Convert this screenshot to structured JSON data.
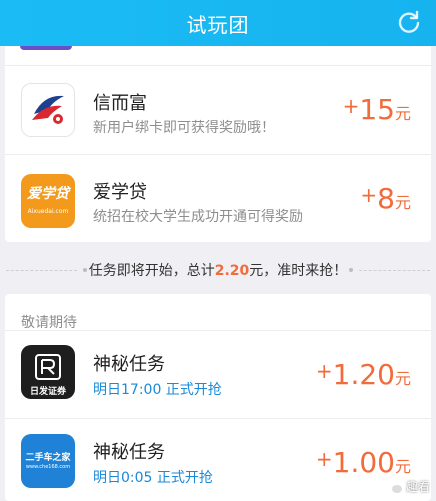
{
  "header": {
    "title": "试玩团",
    "refresh_icon": "refresh-icon"
  },
  "tasks_active": [
    {
      "name": "信而富",
      "desc": "新用户绑卡即可获得奖励哦！",
      "reward_sign": "+",
      "reward_value": "15",
      "reward_unit": "元",
      "logo": "xinerfu-logo"
    },
    {
      "name": "爱学贷",
      "desc": "统招在校大学生成功开通可得奖励",
      "reward_sign": "+",
      "reward_value": "8",
      "reward_unit": "元",
      "logo": "aixuedai-logo",
      "logo_text": "爱学贷",
      "logo_sub": "Aixuedai.com"
    }
  ],
  "notice": {
    "prefix": "任务即将开始，总计",
    "amount": "2.20",
    "suffix": "元，准时来抢！"
  },
  "upcoming": {
    "label": "敬请期待",
    "items": [
      {
        "name": "神秘任务",
        "time": "明日17:00  正式开抢",
        "reward_sign": "+",
        "reward_value": "1.20",
        "reward_unit": "元",
        "logo": "rifa-securities-logo",
        "logo_text": "日发证券"
      },
      {
        "name": "神秘任务",
        "time": "明日0:05  正式开抢",
        "reward_sign": "+",
        "reward_value": "1.00",
        "reward_unit": "元",
        "logo": "che168-logo",
        "logo_text": "二手车之家",
        "logo_sub": "www.che168.com"
      }
    ]
  },
  "watermark": {
    "text": "趣看"
  },
  "colors": {
    "header": "#1bbcf5",
    "reward": "#f26b3a",
    "time": "#1a8ad9"
  }
}
